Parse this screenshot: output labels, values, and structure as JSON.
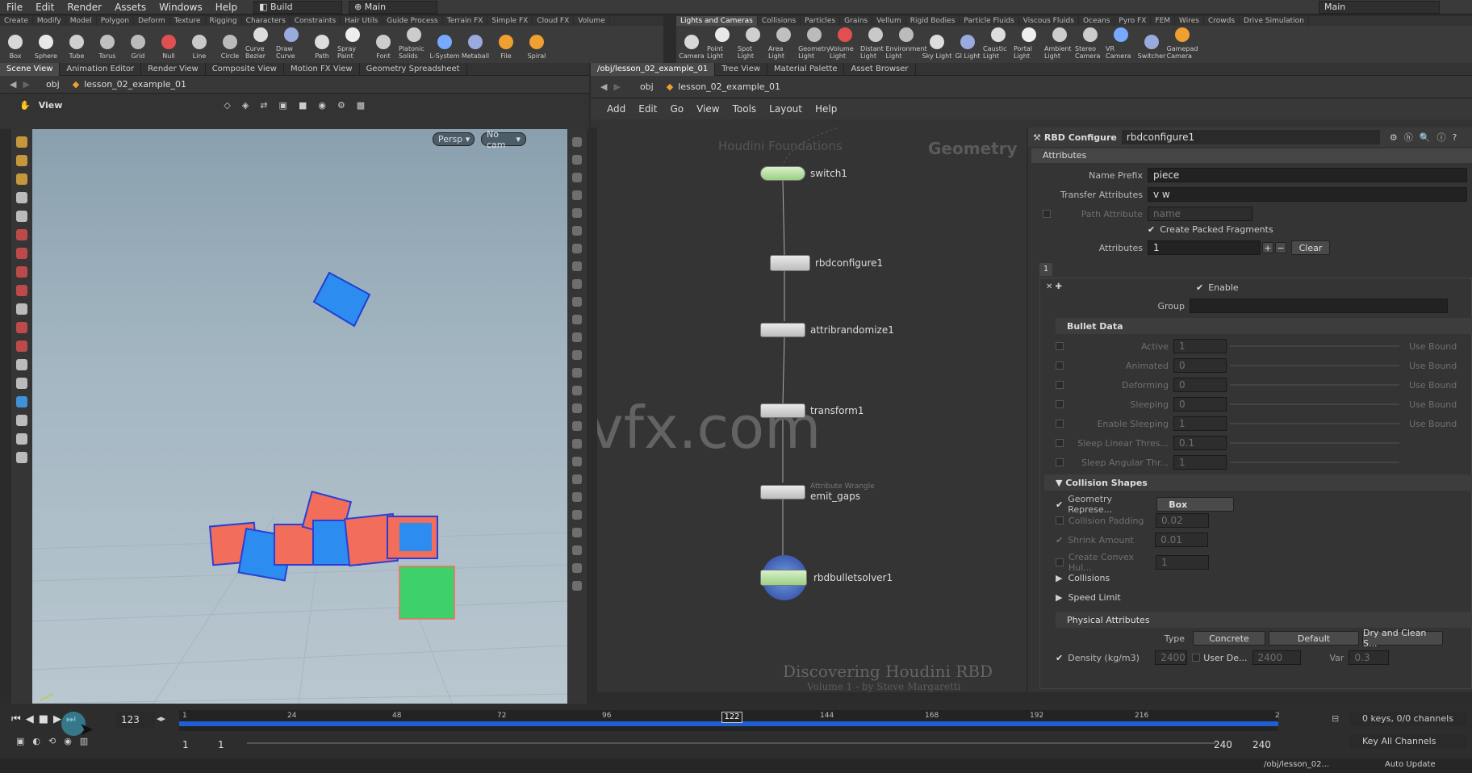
{
  "menu": [
    "File",
    "Edit",
    "Render",
    "Assets",
    "Windows",
    "Help"
  ],
  "desktop_left": "Build",
  "desktop_right": "Main",
  "top_right_desktop": "Main",
  "shelf_left": {
    "tabs": [
      "Create",
      "Modify",
      "Model",
      "Polygon",
      "Deform",
      "Texture",
      "Rigging",
      "Characters",
      "Constraints",
      "Hair Utils",
      "Guide Process",
      "Terrain FX",
      "Simple FX",
      "Cloud FX",
      "Volume"
    ],
    "tools": [
      "Box",
      "Sphere",
      "Tube",
      "Torus",
      "Grid",
      "Null",
      "Line",
      "Circle",
      "Curve Bezier",
      "Draw Curve",
      "Path",
      "Spray Paint",
      "Font",
      "Platonic Solids",
      "L-System",
      "Metaball",
      "File",
      "Spiral"
    ]
  },
  "shelf_right": {
    "tabs": [
      "Lights and Cameras",
      "Collisions",
      "Particles",
      "Grains",
      "Vellum",
      "Rigid Bodies",
      "Particle Fluids",
      "Viscous Fluids",
      "Oceans",
      "Pyro FX",
      "FEM",
      "Wires",
      "Crowds",
      "Drive Simulation"
    ],
    "tools": [
      "Camera",
      "Point Light",
      "Spot Light",
      "Area Light",
      "Geometry Light",
      "Volume Light",
      "Distant Light",
      "Environment Light",
      "Sky Light",
      "GI Light",
      "Caustic Light",
      "Portal Light",
      "Ambient Light",
      "Stereo Camera",
      "VR Camera",
      "Switcher",
      "Gamepad Camera"
    ]
  },
  "left_pane": {
    "tabs": [
      "Scene View",
      "Animation Editor",
      "Render View",
      "Composite View",
      "Motion FX View",
      "Geometry Spreadsheet"
    ],
    "path_obj": "obj",
    "path_node": "lesson_02_example_01",
    "view_label": "View",
    "persp": "Persp",
    "cam": "No cam"
  },
  "right_pane": {
    "tabs": [
      "/obj/lesson_02_example_01",
      "Tree View",
      "Material Palette",
      "Asset Browser"
    ],
    "path_obj": "obj",
    "path_node": "lesson_02_example_01",
    "menu": [
      "Add",
      "Edit",
      "Go",
      "View",
      "Tools",
      "Layout",
      "Help"
    ],
    "context_label": "Geometry",
    "faded_label": "Houdini Foundations",
    "watermark": "Discovering Houdini RBD",
    "watermark_sub": "Volume 1 - by Steve Margaretti",
    "site_watermark": "iivfx.com",
    "nodes": [
      {
        "name": "switch1"
      },
      {
        "name": "rbdconfigure1"
      },
      {
        "name": "attribrandomize1"
      },
      {
        "name": "transform1"
      },
      {
        "name": "emit_gaps",
        "sub": "Attribute Wrangle"
      },
      {
        "name": "rbdbulletsolver1"
      }
    ]
  },
  "params": {
    "node_type": "RBD Configure",
    "node_name": "rbdconfigure1",
    "tab": "Attributes",
    "name_prefix_label": "Name Prefix",
    "name_prefix": "piece",
    "transfer_label": "Transfer Attributes",
    "transfer": "v w",
    "path_attr_label": "Path Attribute",
    "path_attr": "name",
    "create_packed": "Create Packed Fragments",
    "attributes_label": "Attributes",
    "attributes_count": "1",
    "clear": "Clear",
    "multi_index": "1",
    "enable": "Enable",
    "group": "Group",
    "bullet_data": "Bullet Data",
    "bullet_rows": [
      "Active",
      "Animated",
      "Deforming",
      "Sleeping",
      "Enable Sleeping",
      "Sleep Linear Thres...",
      "Sleep Angular Thr..."
    ],
    "bullet_vals": [
      "1",
      "0",
      "0",
      "0",
      "1",
      "0.1",
      "1"
    ],
    "use_bound": "Use Bound",
    "collision_shapes": "Collision Shapes",
    "geo_rep_label": "Geometry Represe...",
    "geo_rep": "Box",
    "collision_padding": "Collision Padding",
    "collision_padding_val": "0.02",
    "shrink_amount": "Shrink Amount",
    "shrink_amount_val": "0.01",
    "convex_hull": "Create Convex Hul...",
    "convex_hull_val": "1",
    "collisions": "Collisions",
    "speed_limit": "Speed Limit",
    "physical": "Physical Attributes",
    "type_label": "Type",
    "type_val": "Concrete",
    "type_default": "Default",
    "dry_clean": "Dry and Clean S...",
    "density_label": "Density (kg/m3)",
    "density_val": "2400",
    "user_de": "User De...",
    "user_de_val": "2400",
    "var": "Var",
    "var_val": "0.3"
  },
  "timeline": {
    "current_frame": "123",
    "marker_frame": "122",
    "ticks": [
      "1",
      "24",
      "48",
      "72",
      "96",
      "122",
      "144",
      "168",
      "192",
      "216",
      "2"
    ],
    "start": "1",
    "start2": "1",
    "end": "240",
    "end2": "240",
    "keys": "0 keys, 0/0 channels",
    "key_all": "Key All Channels",
    "status_path": "/obj/lesson_02...",
    "auto_update": "Auto Update"
  },
  "colors": {
    "accent_blue": "#1f5fd6",
    "piece_red": "#f26d5a",
    "piece_blue": "#2d8cf0",
    "piece_green": "#3ed06a"
  }
}
